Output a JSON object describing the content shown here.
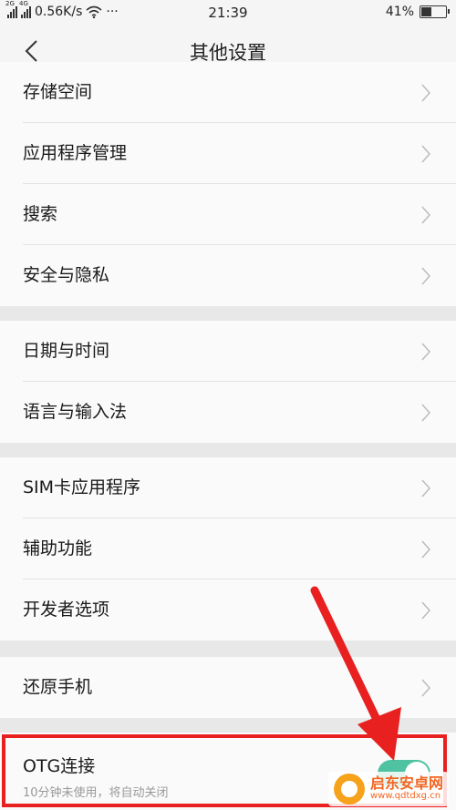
{
  "statusbar": {
    "network_tags": [
      "2G",
      "4G"
    ],
    "speed": "0.56K/s",
    "more": "···",
    "time": "21:39",
    "battery": "41%",
    "battery_level": 0.41
  },
  "navbar": {
    "title": "其他设置"
  },
  "groups": [
    {
      "items": [
        {
          "label": "存储空间"
        },
        {
          "label": "应用程序管理"
        },
        {
          "label": "搜索"
        },
        {
          "label": "安全与隐私"
        }
      ]
    },
    {
      "items": [
        {
          "label": "日期与时间"
        },
        {
          "label": "语言与输入法"
        }
      ]
    },
    {
      "items": [
        {
          "label": "SIM卡应用程序"
        },
        {
          "label": "辅助功能"
        },
        {
          "label": "开发者选项"
        }
      ]
    },
    {
      "items": [
        {
          "label": "还原手机"
        }
      ]
    }
  ],
  "otg": {
    "label": "OTG连接",
    "subtitle": "10分钟未使用，将自动关闭",
    "enabled": true
  },
  "colors": {
    "toggle_on": "#4fc3a1",
    "highlight": "#e82020"
  },
  "watermark": {
    "name": "启东安卓网",
    "url": "www.qdtdxg.cn"
  }
}
